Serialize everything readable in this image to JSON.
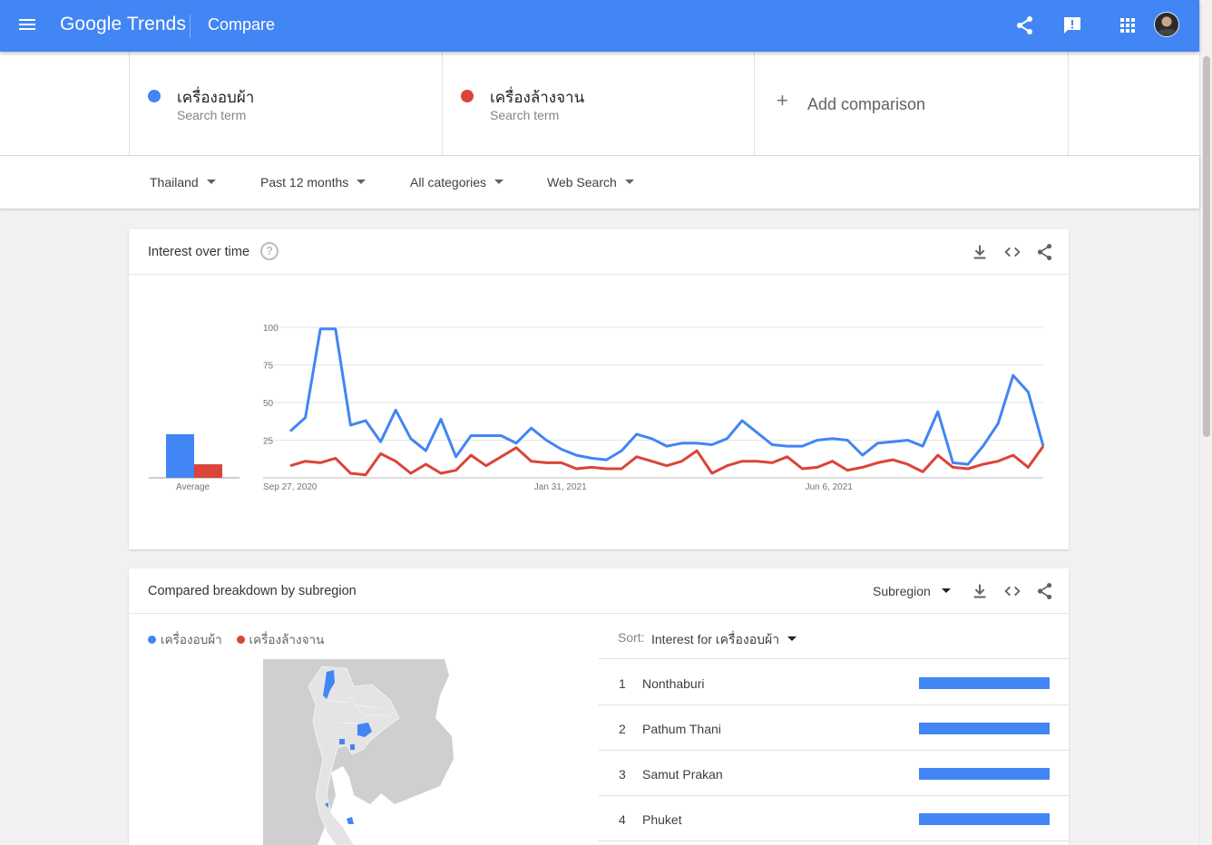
{
  "header": {
    "logo": "Google Trends",
    "title": "Compare"
  },
  "terms": [
    {
      "name": "เครื่องอบผ้า",
      "type": "Search term",
      "color": "#4285f4"
    },
    {
      "name": "เครื่องล้างจาน",
      "type": "Search term",
      "color": "#db4437"
    }
  ],
  "add_comparison": "Add comparison",
  "filters": {
    "region": "Thailand",
    "time": "Past 12 months",
    "category": "All categories",
    "search_type": "Web Search"
  },
  "interest": {
    "title": "Interest over time",
    "average_label": "Average",
    "help": "?"
  },
  "chart_data": {
    "type": "line",
    "title": "Interest over time",
    "x_tick_labels": [
      "Sep 27, 2020",
      "Jan 31, 2021",
      "Jun 6, 2021"
    ],
    "x_tick_indices": [
      0,
      18,
      36
    ],
    "y_ticks": [
      25,
      50,
      75,
      100
    ],
    "ylim": [
      0,
      100
    ],
    "grid": true,
    "averages": [
      {
        "name": "เครื่องอบผ้า",
        "value": 29,
        "color": "#4285f4"
      },
      {
        "name": "เครื่องล้างจาน",
        "value": 9,
        "color": "#db4437"
      }
    ],
    "series": [
      {
        "name": "เครื่องอบผ้า",
        "color": "#4285f4",
        "values": [
          31,
          40,
          99,
          99,
          35,
          38,
          24,
          45,
          26,
          18,
          39,
          14,
          28,
          28,
          28,
          23,
          33,
          25,
          19,
          15,
          13,
          12,
          18,
          29,
          26,
          21,
          23,
          23,
          22,
          26,
          38,
          30,
          22,
          21,
          21,
          25,
          26,
          25,
          15,
          23,
          24,
          25,
          21,
          44,
          10,
          9,
          21,
          36,
          68,
          57,
          21
        ]
      },
      {
        "name": "เครื่องล้างจาน",
        "color": "#db4437",
        "values": [
          8,
          11,
          10,
          13,
          3,
          2,
          16,
          11,
          3,
          9,
          3,
          5,
          15,
          8,
          14,
          20,
          11,
          10,
          10,
          6,
          7,
          6,
          6,
          14,
          11,
          8,
          11,
          18,
          3,
          8,
          11,
          11,
          10,
          14,
          6,
          7,
          11,
          5,
          7,
          10,
          12,
          9,
          4,
          15,
          7,
          6,
          9,
          11,
          15,
          7,
          21
        ]
      }
    ]
  },
  "breakdown": {
    "title": "Compared breakdown by subregion",
    "level": "Subregion",
    "sort_label": "Sort:",
    "sort_value": "Interest for เครื่องอบผ้า",
    "rows": [
      {
        "rank": "1",
        "region": "Nonthaburi",
        "share": 1.0
      },
      {
        "rank": "2",
        "region": "Pathum Thani",
        "share": 1.0
      },
      {
        "rank": "3",
        "region": "Samut Prakan",
        "share": 1.0
      },
      {
        "rank": "4",
        "region": "Phuket",
        "share": 1.0
      }
    ]
  }
}
